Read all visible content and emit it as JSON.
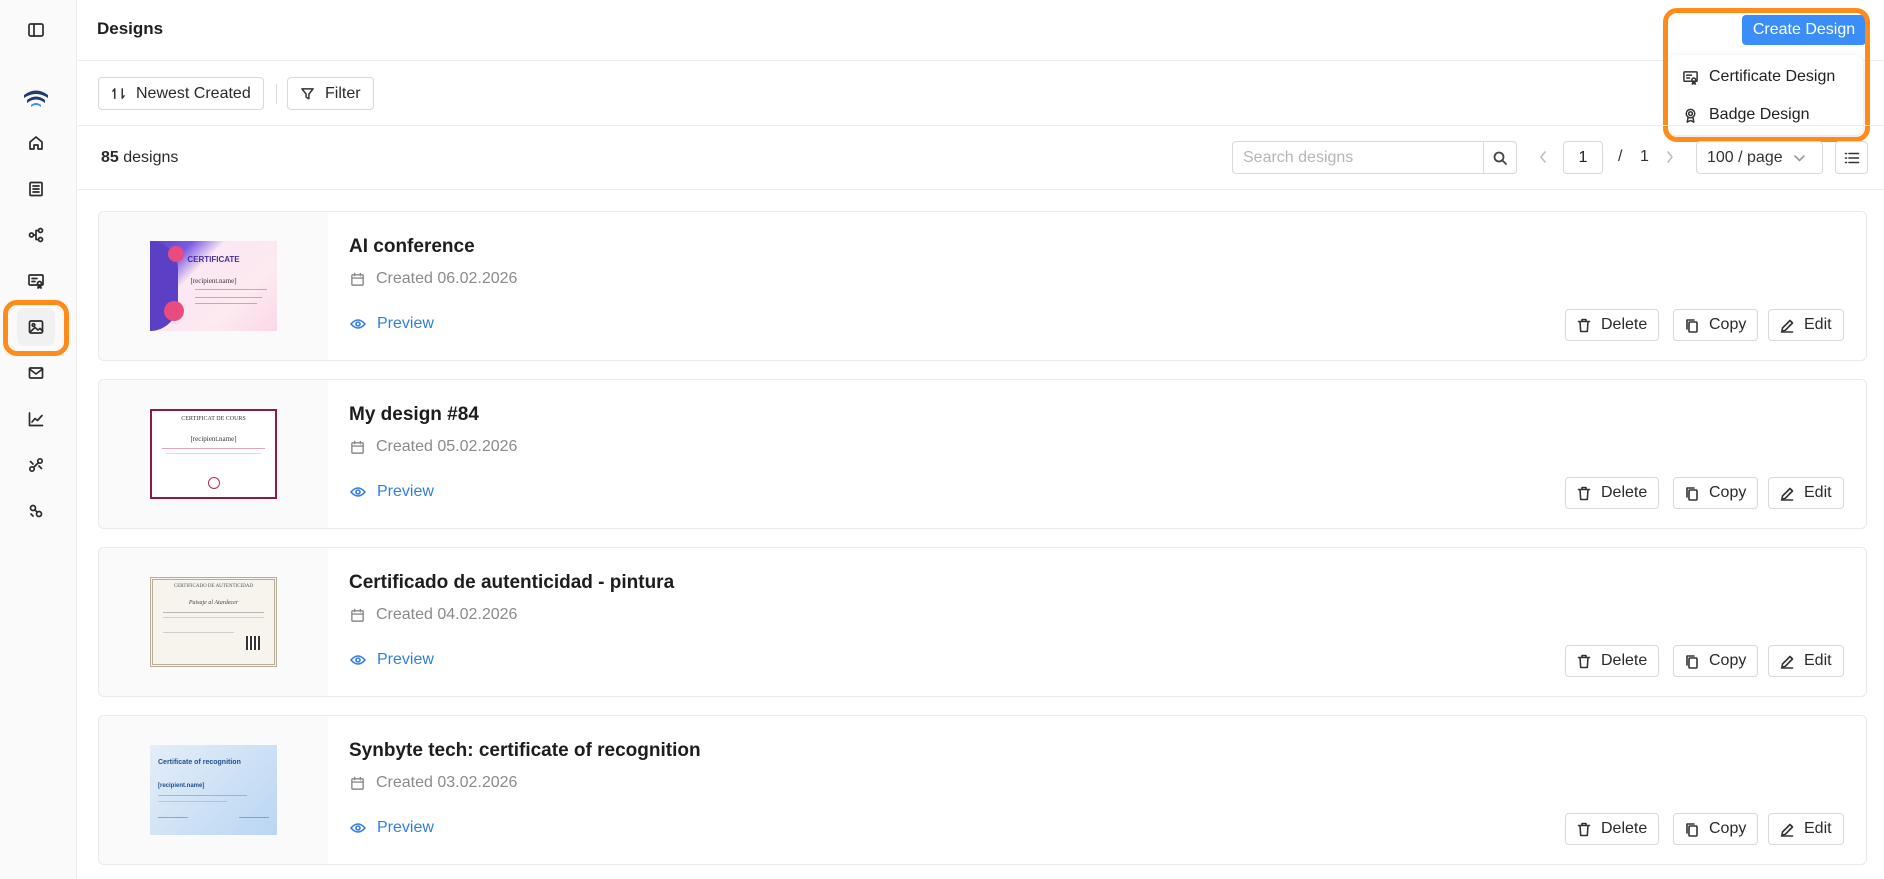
{
  "header": {
    "title": "Designs",
    "create_label": "Create Design"
  },
  "create_menu": {
    "items": [
      {
        "label": "Certificate Design",
        "icon": "certificate-icon"
      },
      {
        "label": "Badge Design",
        "icon": "badge-icon"
      }
    ]
  },
  "toolbar": {
    "sort_label": "Newest Created",
    "filter_label": "Filter"
  },
  "summary": {
    "count": "85",
    "count_suffix": "designs"
  },
  "search": {
    "placeholder": "Search designs",
    "value": ""
  },
  "pagination": {
    "current": "1",
    "separator": "/",
    "total": "1",
    "per_page": "100 / page"
  },
  "sidebar": {
    "items": [
      {
        "icon": "panel-toggle-icon"
      },
      {
        "icon": "logo-icon"
      },
      {
        "icon": "home-icon"
      },
      {
        "icon": "building-icon"
      },
      {
        "icon": "workflow-icon"
      },
      {
        "icon": "certificate-icon"
      },
      {
        "icon": "image-icon",
        "active": true
      },
      {
        "icon": "mail-icon"
      },
      {
        "icon": "chart-icon"
      },
      {
        "icon": "integration-icon"
      },
      {
        "icon": "link-icon"
      }
    ]
  },
  "designs": [
    {
      "title": "AI conference",
      "created": "Created 06.02.2026",
      "preview_label": "Preview",
      "thumb": {
        "title": "CERTIFICATE",
        "name": "[recipient.name]"
      }
    },
    {
      "title": "My design #84",
      "created": "Created 05.02.2026",
      "preview_label": "Preview",
      "thumb": {
        "title": "CERTIFICAT DE COURS",
        "name": "[recipient.name]"
      }
    },
    {
      "title": "Certificado de autenticidad - pintura",
      "created": "Created 04.02.2026",
      "preview_label": "Preview",
      "thumb": {
        "title": "CERTIFICADO DE AUTENTICIDAD",
        "name": "Paisaje al Atardecer"
      }
    },
    {
      "title": "Synbyte tech: certificate of recognition",
      "created": "Created 03.02.2026",
      "preview_label": "Preview",
      "thumb": {
        "title": "Certificate of recognition",
        "name": "[recipient.name]"
      }
    }
  ],
  "actions": {
    "delete_label": "Delete",
    "copy_label": "Copy",
    "edit_label": "Edit"
  },
  "colors": {
    "accent": "#3b8ef7",
    "link": "#2f7fe0",
    "highlight": "#ff8c1a"
  }
}
